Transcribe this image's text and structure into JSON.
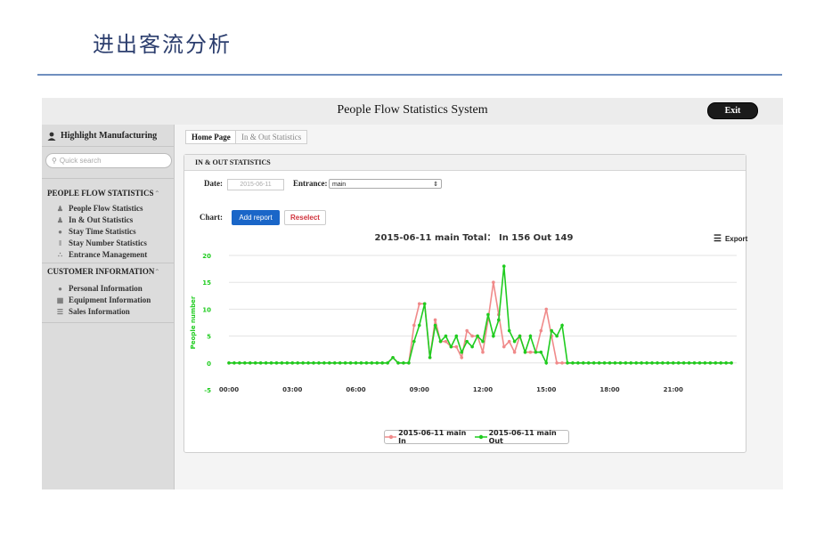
{
  "slide": {
    "title": "进出客流分析"
  },
  "app": {
    "title": "People Flow Statistics System",
    "exit_label": "Exit"
  },
  "sidebar": {
    "company": "Highlight Manufacturing",
    "search_placeholder": "Quick search",
    "sections": [
      {
        "label": "PEOPLE FLOW STATISTICS",
        "items": [
          {
            "label": "People Flow Statistics",
            "icon": "people-icon"
          },
          {
            "label": "In & Out Statistics",
            "icon": "people-icon"
          },
          {
            "label": "Stay Time Statistics",
            "icon": "person-icon"
          },
          {
            "label": "Stay Number Statistics",
            "icon": "bars-icon"
          },
          {
            "label": "Entrance Management",
            "icon": "network-icon"
          }
        ]
      },
      {
        "label": "CUSTOMER INFORMATION",
        "items": [
          {
            "label": "Personal Information",
            "icon": "person-icon"
          },
          {
            "label": "Equipment Information",
            "icon": "device-icon"
          },
          {
            "label": "Sales Information",
            "icon": "list-icon"
          }
        ]
      }
    ]
  },
  "breadcrumb": {
    "home": "Home Page",
    "current": "In & Out Statistics"
  },
  "panel": {
    "title": "IN & OUT STATISTICS",
    "date_label": "Date:",
    "date_value": "2015-06-11",
    "entrance_label": "Entrance:",
    "entrance_value": "main",
    "chart_label": "Chart:",
    "add_report": "Add report",
    "reselect": "Reselect",
    "export": "Export"
  },
  "colors": {
    "in": "#f08a8a",
    "out": "#1fcc1f",
    "accent": "#1a66c8"
  },
  "chart_data": {
    "type": "line",
    "title": "2015-06-11 main Total：  In 156 Out 149",
    "ylabel": "People number",
    "xlabel": "",
    "ylim": [
      -5,
      20
    ],
    "yticks": [
      -5,
      0,
      5,
      10,
      15,
      20
    ],
    "x_tick_labels": [
      "00:00",
      "03:00",
      "06:00",
      "09:00",
      "12:00",
      "15:00",
      "18:00",
      "21:00"
    ],
    "x_unit": "15-minute slots from 00:00",
    "grid": true,
    "legend": "bottom-center",
    "series": [
      {
        "name": "2015-06-11 main In",
        "color": "#f08a8a",
        "values": [
          0,
          0,
          0,
          0,
          0,
          0,
          0,
          0,
          0,
          0,
          0,
          0,
          0,
          0,
          0,
          0,
          0,
          0,
          0,
          0,
          0,
          0,
          0,
          0,
          0,
          0,
          0,
          0,
          0,
          0,
          0,
          1,
          0,
          0,
          0,
          7,
          11,
          11,
          1,
          8,
          4,
          4,
          3,
          3,
          1,
          6,
          5,
          5,
          2,
          8,
          15,
          9,
          3,
          4,
          2,
          5,
          2,
          2,
          2,
          6,
          10,
          5,
          0,
          0,
          0,
          0,
          0,
          0,
          0,
          0,
          0,
          0,
          0,
          0,
          0,
          0,
          0,
          0,
          0,
          0,
          0,
          0,
          0,
          0,
          0,
          0,
          0,
          0,
          0,
          0,
          0,
          0,
          0,
          0,
          0,
          0
        ]
      },
      {
        "name": "2015-06-11 main Out",
        "color": "#1fcc1f",
        "values": [
          0,
          0,
          0,
          0,
          0,
          0,
          0,
          0,
          0,
          0,
          0,
          0,
          0,
          0,
          0,
          0,
          0,
          0,
          0,
          0,
          0,
          0,
          0,
          0,
          0,
          0,
          0,
          0,
          0,
          0,
          0,
          1,
          0,
          0,
          0,
          4,
          7,
          11,
          1,
          7,
          4,
          5,
          3,
          5,
          2,
          4,
          3,
          5,
          4,
          9,
          5,
          8,
          18,
          6,
          4,
          5,
          2,
          5,
          2,
          2,
          0,
          6,
          5,
          7,
          0,
          0,
          0,
          0,
          0,
          0,
          0,
          0,
          0,
          0,
          0,
          0,
          0,
          0,
          0,
          0,
          0,
          0,
          0,
          0,
          0,
          0,
          0,
          0,
          0,
          0,
          0,
          0,
          0,
          0,
          0,
          0
        ]
      }
    ]
  }
}
